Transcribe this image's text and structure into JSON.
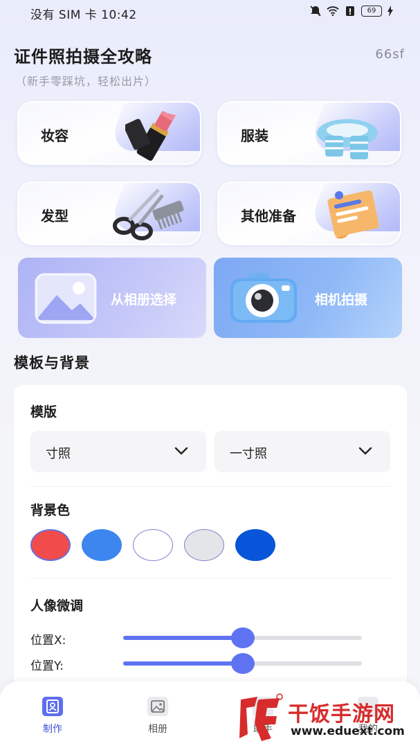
{
  "status_bar": {
    "carrier_time": "没有 SIM 卡 10:42",
    "battery": "69"
  },
  "header": {
    "title": "证件照拍摄全攻略",
    "subtitle": "（新手零踩坑，轻松出片）",
    "user_code": "66sf"
  },
  "tips": [
    {
      "label": "妆容",
      "icon": "lipstick-icon"
    },
    {
      "label": "服装",
      "icon": "scarf-icon"
    },
    {
      "label": "发型",
      "icon": "scissors-comb-icon"
    },
    {
      "label": "其他准备",
      "icon": "document-icon"
    }
  ],
  "actions": {
    "album": {
      "label": "从相册选择",
      "icon": "image-icon"
    },
    "camera": {
      "label": "相机拍摄",
      "icon": "camera-icon"
    }
  },
  "section_title": "模板与背景",
  "template": {
    "label": "模版",
    "category": "寸照",
    "size": "一寸照"
  },
  "background": {
    "label": "背景色",
    "colors": [
      "#f24b4b",
      "#3d86ef",
      "#ffffff",
      "#e4e5e8",
      "#0756d9"
    ],
    "selected_index": 0
  },
  "portrait": {
    "label": "人像微调",
    "sliders": [
      {
        "label": "位置X:",
        "value": 0.5
      },
      {
        "label": "位置Y:",
        "value": 0.5
      }
    ]
  },
  "nav": {
    "make": "制作",
    "album": "相册",
    "partial_3": "助手",
    "partial_4": "我的"
  },
  "watermark": {
    "text": "干饭手游网",
    "url": "www.eduext.com"
  },
  "colors": {
    "accent": "#5f73f2",
    "nav_active": "#3e52d8"
  }
}
